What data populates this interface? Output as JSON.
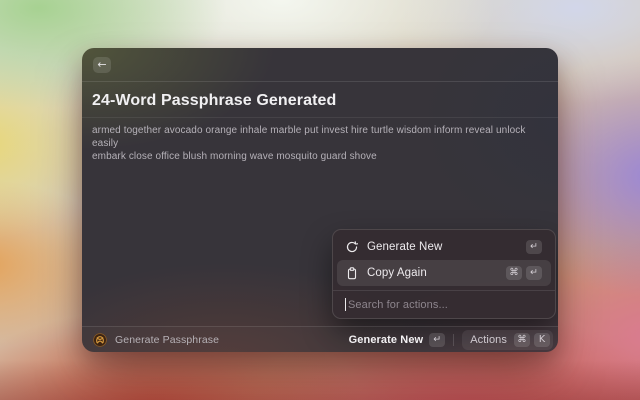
{
  "window": {
    "back_icon": "←",
    "title": "24-Word Passphrase Generated",
    "passphrase": {
      "line1": "armed together avocado orange inhale marble put invest hire turtle wisdom inform reveal unlock easily",
      "line2": "embark close office blush morning wave mosquito guard shove"
    }
  },
  "action_panel": {
    "items": [
      {
        "label": "Generate New",
        "icon": "refresh-icon",
        "shortcuts": [
          "↵"
        ],
        "selected": false
      },
      {
        "label": "Copy Again",
        "icon": "clipboard-icon",
        "shortcuts": [
          "⌘",
          "↵"
        ],
        "selected": true
      }
    ],
    "search_placeholder": "Search for actions..."
  },
  "status_bar": {
    "app_icon": "pretzel-logo",
    "app_name": "Generate Passphrase",
    "primary_action": {
      "label": "Generate New",
      "shortcut": "↵"
    },
    "actions_button": {
      "label": "Actions",
      "shortcuts": [
        "⌘",
        "K"
      ]
    }
  },
  "colors": {
    "window_surface": "#37343a",
    "panel_surface": "#352c31",
    "selection": "rgba(255,255,255,0.09)",
    "extension_icon_gold": "#d79a3e"
  }
}
